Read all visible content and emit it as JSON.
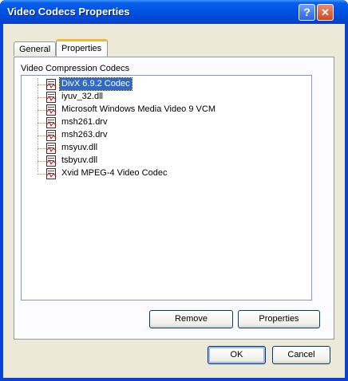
{
  "window": {
    "title": "Video Codecs Properties",
    "help_glyph": "?",
    "close_glyph": "✕"
  },
  "tabs": [
    {
      "label": "General"
    },
    {
      "label": "Properties"
    }
  ],
  "group": {
    "label": "Video Compression Codecs"
  },
  "codecs": [
    {
      "name": "DivX 6.9.2 Codec",
      "selected": true
    },
    {
      "name": "iyuv_32.dll"
    },
    {
      "name": "Microsoft Windows Media Video 9 VCM"
    },
    {
      "name": "msh261.drv"
    },
    {
      "name": "msh263.drv"
    },
    {
      "name": "msyuv.dll"
    },
    {
      "name": "tsbyuv.dll"
    },
    {
      "name": "Xvid MPEG-4 Video Codec"
    }
  ],
  "actions": {
    "remove_label": "Remove",
    "properties_label": "Properties"
  },
  "dialog": {
    "ok_label": "OK",
    "cancel_label": "Cancel"
  },
  "colors": {
    "titlebar": "#0054e3",
    "selection": "#316ac5",
    "face": "#ece9d8"
  }
}
